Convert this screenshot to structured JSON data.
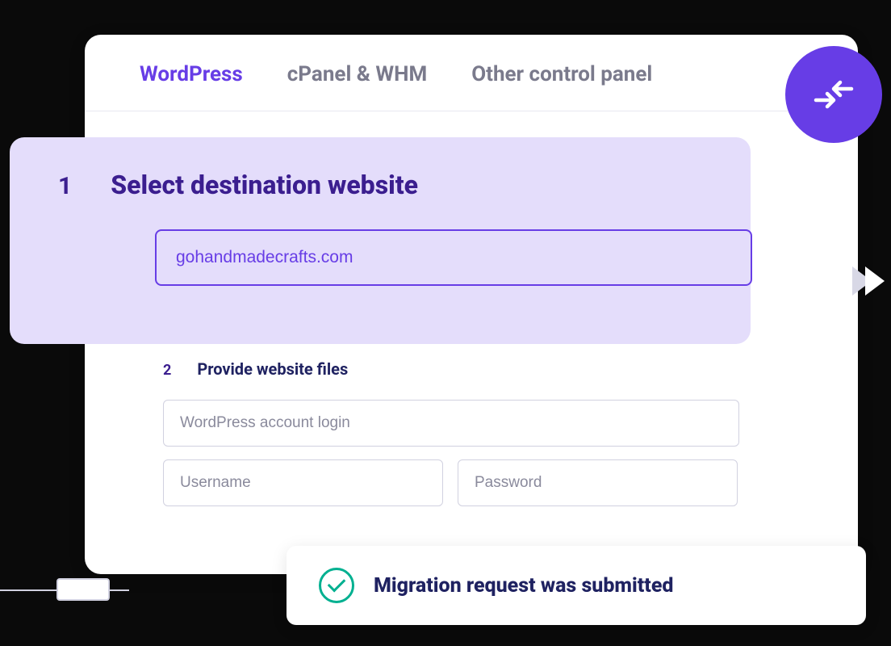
{
  "tabs": {
    "wordpress": "WordPress",
    "cpanel": "cPanel & WHM",
    "other": "Other control panel"
  },
  "step1": {
    "num": "1",
    "title": "Select destination website",
    "input_value": "gohandmadecrafts.com"
  },
  "step2": {
    "num": "2",
    "title": "Provide website files",
    "login_placeholder": "WordPress account login",
    "username_placeholder": "Username",
    "password_placeholder": "Password"
  },
  "toast": {
    "message": "Migration request was submitted"
  }
}
